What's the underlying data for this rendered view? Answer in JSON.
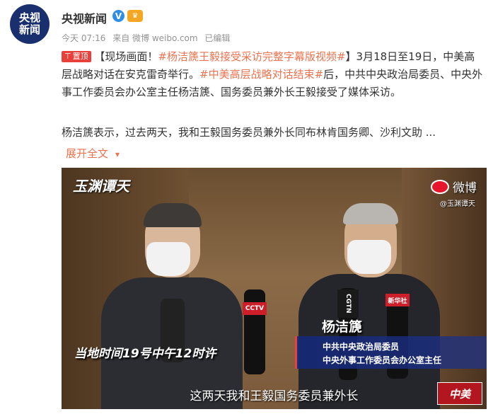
{
  "account": {
    "avatar_text_line1": "央视",
    "avatar_text_line2": "新闻",
    "name": "央视新闻",
    "verified_badge": "V"
  },
  "meta": {
    "time": "今天 07:16",
    "source": "来自 微博 weibo.com",
    "edited": "已编辑"
  },
  "post": {
    "pin_label": "置顶",
    "text_a": "【现场画面！",
    "hashtag_1": "#杨洁篪王毅接受采访完整字幕版视频#",
    "text_b": "】3月18日至19日，中美高层战略对话在安克雷奇举行。",
    "hashtag_2": "#中美高层战略对话结束#",
    "text_c": "后，中共中央政治局委员、中央外事工作委员会办公室主任杨洁篪、国务委员兼外长王毅接受了媒体采访。",
    "second_para": "杨洁篪表示，过去两天，我和王毅国务委员兼外长同布林肯国务卿、沙利文助 ...",
    "expand_label": "展开全文"
  },
  "video": {
    "corner_watermark": "玉渊谭天",
    "weibo_label": "微博",
    "weibo_sub": "@玉渊谭天",
    "time_caption": "当地时间19号中午12时许",
    "speaker_name": "杨洁篪",
    "speaker_title_1": "中共中央政治局委员",
    "speaker_title_2": "中央外事工作委员会办公室主任",
    "subtitle": "这两天我和王毅国务委员兼外长",
    "mic_label_1": "CCTV",
    "mic_label_2": "新华社",
    "mic_label_3": "CGTN",
    "corner_logo": "中美"
  },
  "colors": {
    "hashtag": "#eb7350",
    "pin": "#e8413b",
    "verified": "#2d8ee8"
  }
}
